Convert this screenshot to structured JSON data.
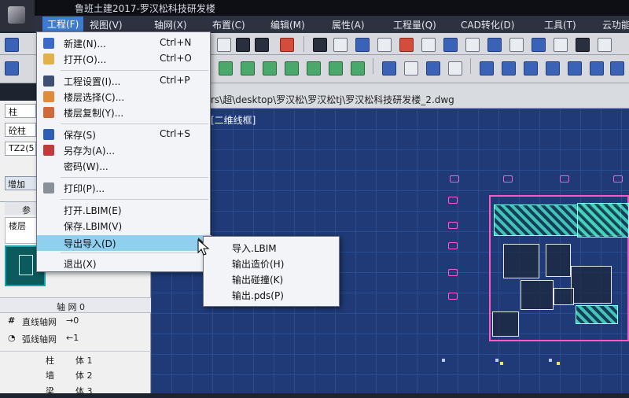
{
  "window": {
    "title": "鲁班土建2017-罗汉松科技研发楼",
    "file_path": "rs\\超\\desktop\\罗汉松\\罗汉松tj\\罗汉松科技研发楼_2.dwg",
    "view_label": "[二维线框]"
  },
  "menubar": {
    "items": [
      {
        "label": "工程(F)",
        "active": true
      },
      {
        "label": "视图(V)"
      },
      {
        "label": "轴网(X)"
      },
      {
        "label": "布置(C)"
      },
      {
        "label": "编辑(M)"
      },
      {
        "label": "属性(A)"
      },
      {
        "label": "工程量(Q)"
      },
      {
        "label": "CAD转化(D)"
      },
      {
        "label": "工具(T)"
      },
      {
        "label": "云功能"
      }
    ]
  },
  "file_menu": {
    "items": [
      {
        "label": "新建(N)...",
        "shortcut": "Ctrl+N",
        "icon": "new-file-icon"
      },
      {
        "label": "打开(O)...",
        "shortcut": "Ctrl+O",
        "icon": "open-folder-icon"
      },
      {
        "label": "工程设置(I)...",
        "shortcut": "Ctrl+P",
        "icon": "project-settings-icon"
      },
      {
        "label": "楼层选择(C)...",
        "shortcut": "",
        "icon": "floor-select-icon"
      },
      {
        "label": "楼层复制(Y)...",
        "shortcut": "",
        "icon": "floor-copy-icon"
      },
      {
        "label": "保存(S)",
        "shortcut": "Ctrl+S",
        "icon": "save-icon"
      },
      {
        "label": "另存为(A)...",
        "shortcut": "",
        "icon": "save-as-icon"
      },
      {
        "label": "密码(W)...",
        "shortcut": "",
        "icon": ""
      },
      {
        "label": "打印(P)...",
        "shortcut": "",
        "icon": "print-icon"
      },
      {
        "label": "打开.LBIM(E)",
        "shortcut": "",
        "icon": ""
      },
      {
        "label": "保存.LBIM(V)",
        "shortcut": "",
        "icon": ""
      },
      {
        "label": "导出导入(D)",
        "shortcut": "",
        "icon": "",
        "highlight": true
      },
      {
        "label": "退出(X)",
        "shortcut": "",
        "icon": ""
      }
    ]
  },
  "submenu": {
    "items": [
      {
        "label": "导入.LBIM"
      },
      {
        "label": "输出造价(H)"
      },
      {
        "label": "输出碰撞(K)"
      },
      {
        "label": "输出.pds(P)"
      }
    ]
  },
  "left_panel": {
    "component_type": "柱",
    "component_subtype": "砼柱",
    "component_name": "TZ2(5",
    "add_button": "增加",
    "tab_label": "参",
    "list_item": "楼层",
    "tree_header": "轴   网  0",
    "rows": [
      {
        "label": "直线轴网",
        "count": "→0",
        "icon": "straight-grid-icon"
      },
      {
        "label": "弧线轴网",
        "count": "←1",
        "icon": "arc-grid-icon"
      },
      {
        "label": "柱",
        "count": "体 1",
        "icon": ""
      },
      {
        "label": "墙",
        "count": "体 2",
        "icon": ""
      },
      {
        "label": "梁",
        "count": "体 3",
        "icon": ""
      }
    ]
  },
  "colors": {
    "canvas_bg": "#1f3a76",
    "menu_highlight": "#8fd0ee",
    "pillar_outline": "#ff5bd3",
    "menubar_bg": "#2e3140"
  }
}
